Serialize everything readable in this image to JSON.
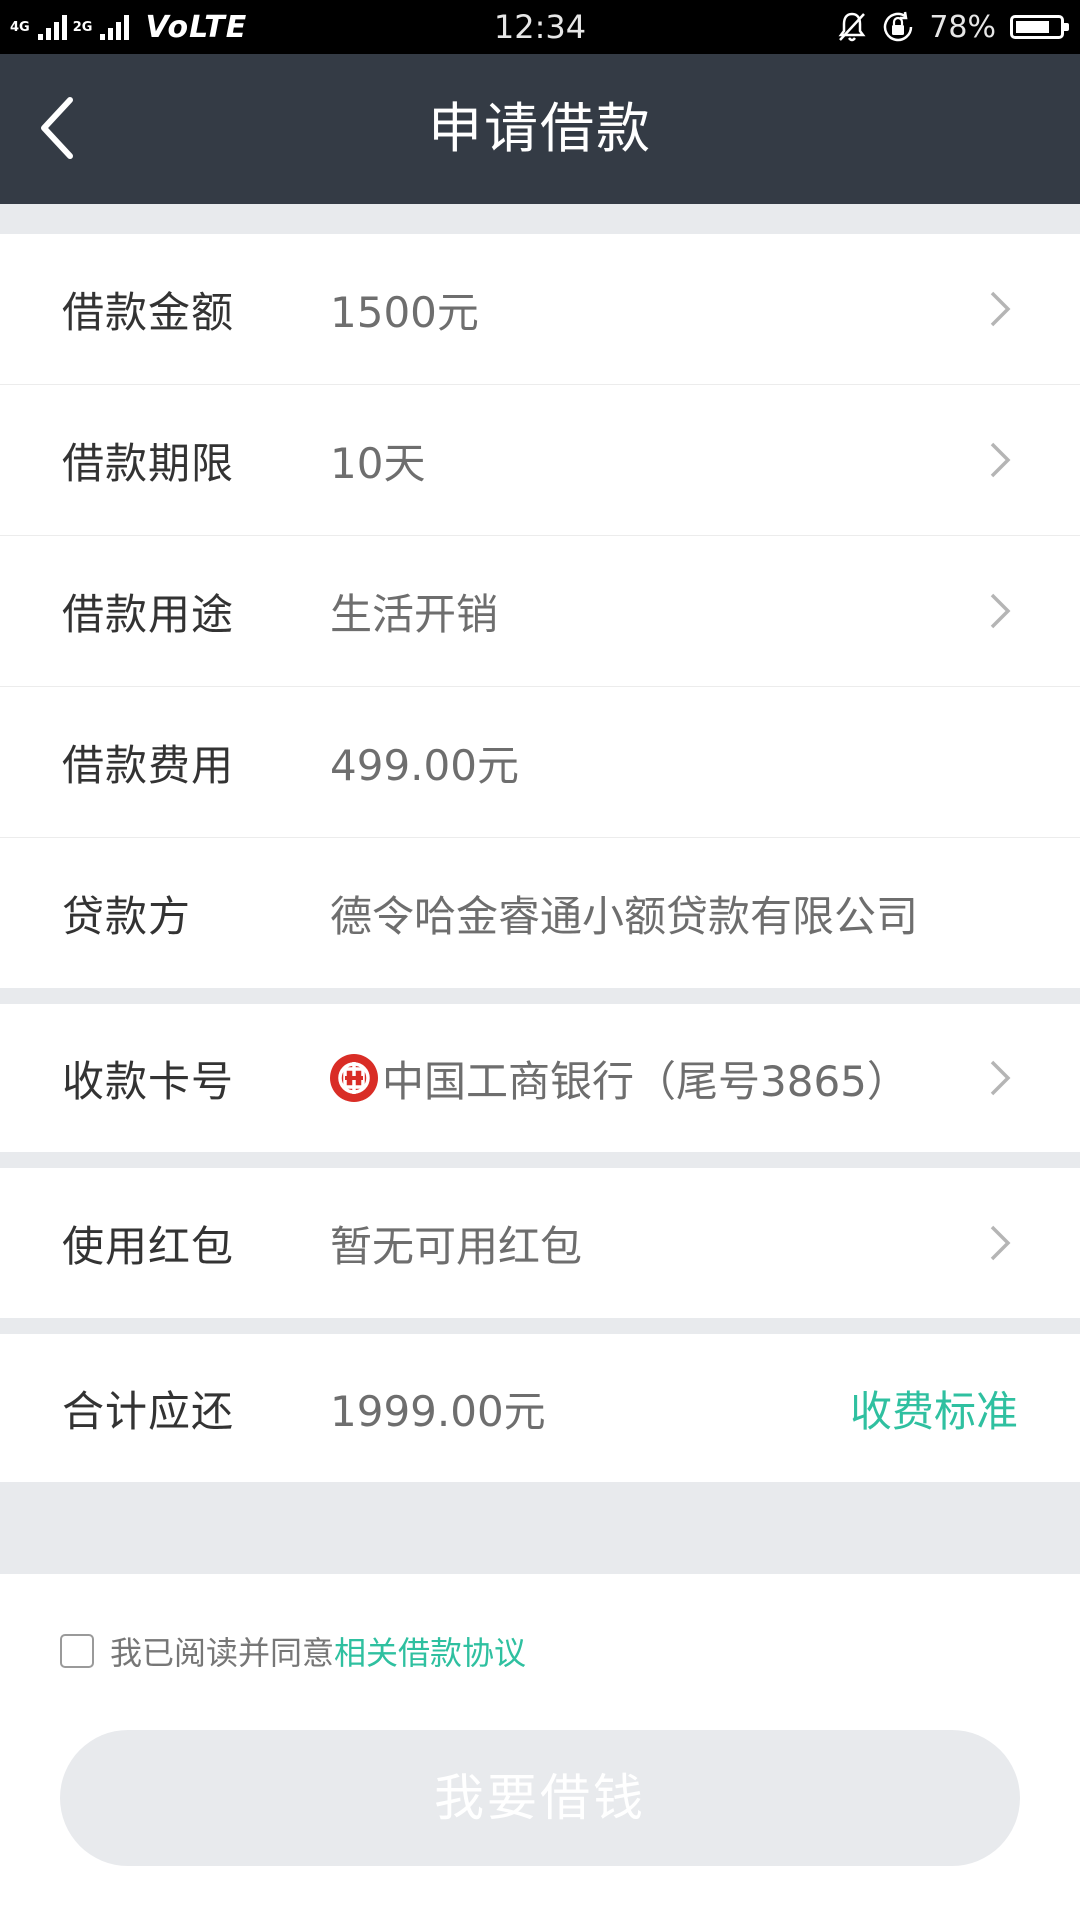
{
  "status_bar": {
    "network_top": "4G",
    "network_bottom": "2G",
    "volte": "VoLTE",
    "time": "12:34",
    "battery_percent": "78%",
    "battery_level": 0.78
  },
  "header": {
    "title": "申请借款",
    "back_icon": "chevron-left-icon"
  },
  "loan_form": {
    "rows": [
      {
        "label": "借款金额",
        "value": "1500元",
        "has_arrow": true
      },
      {
        "label": "借款期限",
        "value": "10天",
        "has_arrow": true
      },
      {
        "label": "借款用途",
        "value": "生活开销",
        "has_arrow": true
      },
      {
        "label": "借款费用",
        "value": "499.00元",
        "has_arrow": false
      },
      {
        "label": "贷款方",
        "value": "德令哈金睿通小额贷款有限公司",
        "has_arrow": false
      }
    ]
  },
  "card": {
    "label": "收款卡号",
    "bank_icon": "icbc-logo-icon",
    "value": "中国工商银行（尾号3865）"
  },
  "red_packet": {
    "label": "使用红包",
    "value": "暂无可用红包"
  },
  "total": {
    "label": "合计应还",
    "value": "1999.00元",
    "link": "收费标准"
  },
  "agreement": {
    "checked": false,
    "prefix": "我已阅读并同意",
    "link": "相关借款协议"
  },
  "submit_button": {
    "label": "我要借钱",
    "enabled": false
  },
  "colors": {
    "header_bg": "#343b45",
    "accent": "#2fc0a0",
    "separator": "#e8eaed",
    "icbc_red": "#d92d26"
  }
}
